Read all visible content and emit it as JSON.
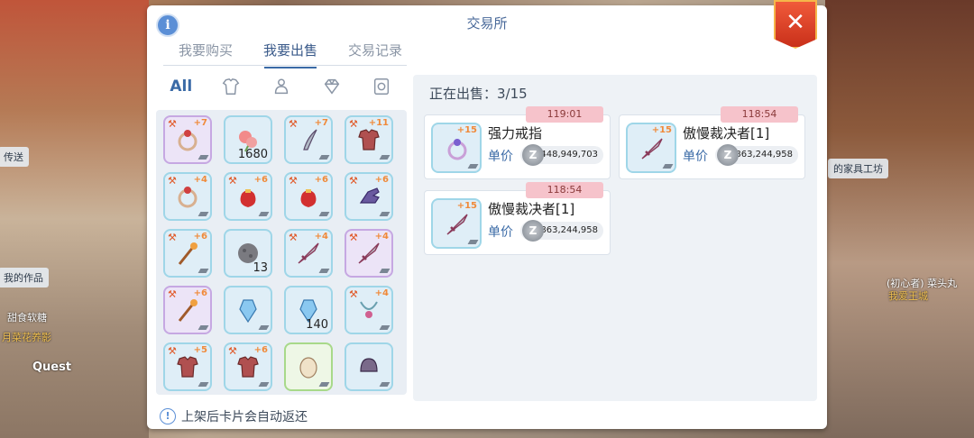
{
  "background": {
    "labels": [
      "传送",
      "我的作品",
      "的家具工坊"
    ],
    "names": [
      "甜食软糖",
      "月菜花养影",
      "Quest",
      "(初心者) 菜头丸",
      "我爱王城"
    ]
  },
  "window": {
    "title": "交易所",
    "info_icon": "i",
    "close_icon": "✕"
  },
  "tabs": [
    {
      "label": "我要购买",
      "active": false
    },
    {
      "label": "我要出售",
      "active": true
    },
    {
      "label": "交易记录",
      "active": false
    }
  ],
  "filters": {
    "all_label": "All",
    "icons": [
      "armor-icon",
      "accessory-icon",
      "gem-icon",
      "card-icon"
    ]
  },
  "inventory": [
    {
      "icon": "ring-icon",
      "level": "+7",
      "count": "",
      "rarity": "purple"
    },
    {
      "icon": "flower-icon",
      "level": "",
      "count": "1680",
      "rarity": "blue"
    },
    {
      "icon": "dagger-icon",
      "level": "+7",
      "count": "",
      "rarity": "blue"
    },
    {
      "icon": "armor-icon",
      "level": "+11",
      "count": "",
      "rarity": "blue"
    },
    {
      "icon": "ring-icon",
      "level": "+4",
      "count": "",
      "rarity": "blue"
    },
    {
      "icon": "bag-icon",
      "level": "+6",
      "count": "",
      "rarity": "blue"
    },
    {
      "icon": "bag-icon",
      "level": "+6",
      "count": "",
      "rarity": "blue"
    },
    {
      "icon": "glove-icon",
      "level": "+6",
      "count": "",
      "rarity": "blue"
    },
    {
      "icon": "staff-icon",
      "level": "+6",
      "count": "",
      "rarity": "blue"
    },
    {
      "icon": "stone-icon",
      "level": "",
      "count": "13",
      "rarity": "blue"
    },
    {
      "icon": "sword-icon",
      "level": "+4",
      "count": "",
      "rarity": "blue"
    },
    {
      "icon": "sword-icon",
      "level": "+4",
      "count": "",
      "rarity": "purple"
    },
    {
      "icon": "staff-icon",
      "level": "+6",
      "count": "",
      "rarity": "purple"
    },
    {
      "icon": "crystal-icon",
      "level": "",
      "count": "",
      "rarity": "blue"
    },
    {
      "icon": "crystal-icon",
      "level": "",
      "count": "140",
      "rarity": "blue"
    },
    {
      "icon": "necklace-icon",
      "level": "+4",
      "count": "",
      "rarity": "blue"
    },
    {
      "icon": "armor-icon",
      "level": "+5",
      "count": "",
      "rarity": "blue"
    },
    {
      "icon": "armor-icon",
      "level": "+6",
      "count": "",
      "rarity": "blue"
    },
    {
      "icon": "egg-icon",
      "level": "",
      "count": "",
      "rarity": "green"
    },
    {
      "icon": "helmet-icon",
      "level": "",
      "count": "",
      "rarity": "blue"
    }
  ],
  "notice": {
    "icon": "!",
    "text": "上架后卡片会自动返还"
  },
  "selling": {
    "header": "正在出售：3/15",
    "price_label": "单价",
    "zeny_icon": "Z",
    "listings": [
      {
        "name": "强力戒指",
        "level": "+15",
        "timer": "119:01",
        "price": "448,949,703",
        "icon": "ring-icon"
      },
      {
        "name": "傲慢裁决者[1]",
        "level": "+15",
        "timer": "118:54",
        "price": "863,244,958",
        "icon": "sword-icon"
      },
      {
        "name": "傲慢裁决者[1]",
        "level": "+15",
        "timer": "118:54",
        "price": "863,244,958",
        "icon": "sword-icon"
      }
    ]
  }
}
